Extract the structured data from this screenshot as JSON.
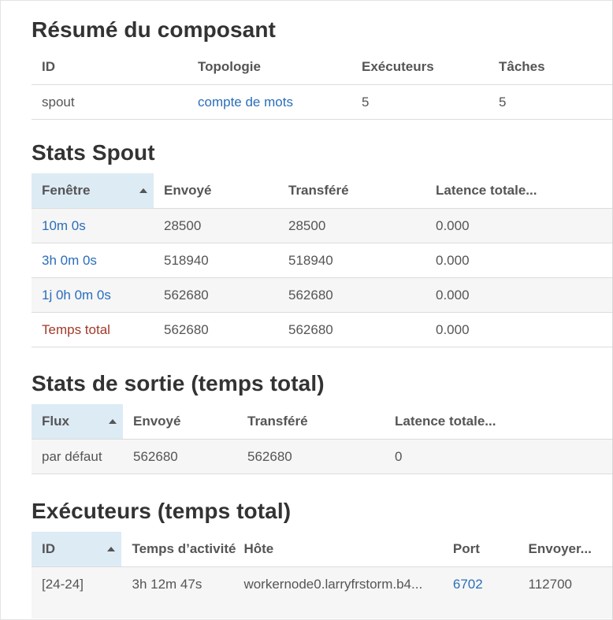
{
  "summary": {
    "title": "Résumé du composant",
    "headers": [
      "ID",
      "Topologie",
      "Exécuteurs",
      "Tâches"
    ],
    "row": {
      "id": "spout",
      "topology": "compte de mots",
      "executors": "5",
      "tasks": "5"
    }
  },
  "spout_stats": {
    "title": "Stats Spout",
    "headers": [
      "Fenêtre",
      "Envoyé",
      "Transféré",
      "Latence totale..."
    ],
    "rows": [
      {
        "window": "10m 0s",
        "sent": "28500",
        "transferred": "28500",
        "latency": "0.000"
      },
      {
        "window": "3h 0m 0s",
        "sent": "518940",
        "transferred": "518940",
        "latency": "0.000"
      },
      {
        "window": "1j 0h 0m 0s",
        "sent": "562680",
        "transferred": "562680",
        "latency": "0.000"
      },
      {
        "window": "Temps total",
        "sent": "562680",
        "transferred": "562680",
        "latency": "0.000"
      }
    ]
  },
  "output_stats": {
    "title": "Stats de sortie (temps total)",
    "headers": [
      "Flux",
      "Envoyé",
      "Transféré",
      "Latence totale..."
    ],
    "rows": [
      {
        "stream": "par défaut",
        "sent": "562680",
        "transferred": "562680",
        "latency": "0"
      }
    ]
  },
  "executors": {
    "title": "Exécuteurs (temps total)",
    "headers": [
      "ID",
      "Temps d’activité",
      "Hôte",
      "Port",
      "Envoyer..."
    ],
    "rows": [
      {
        "id": "[24-24]",
        "uptime": "3h 12m 47s",
        "host": "workernode0.larryfrstorm.b4...",
        "port": "6702",
        "sent": "112700"
      }
    ]
  },
  "colors": {
    "link": "#2a6ebb",
    "link_total": "#a23a2a",
    "sorted_header": "#ddebf5",
    "stripe": "#f6f6f6"
  }
}
